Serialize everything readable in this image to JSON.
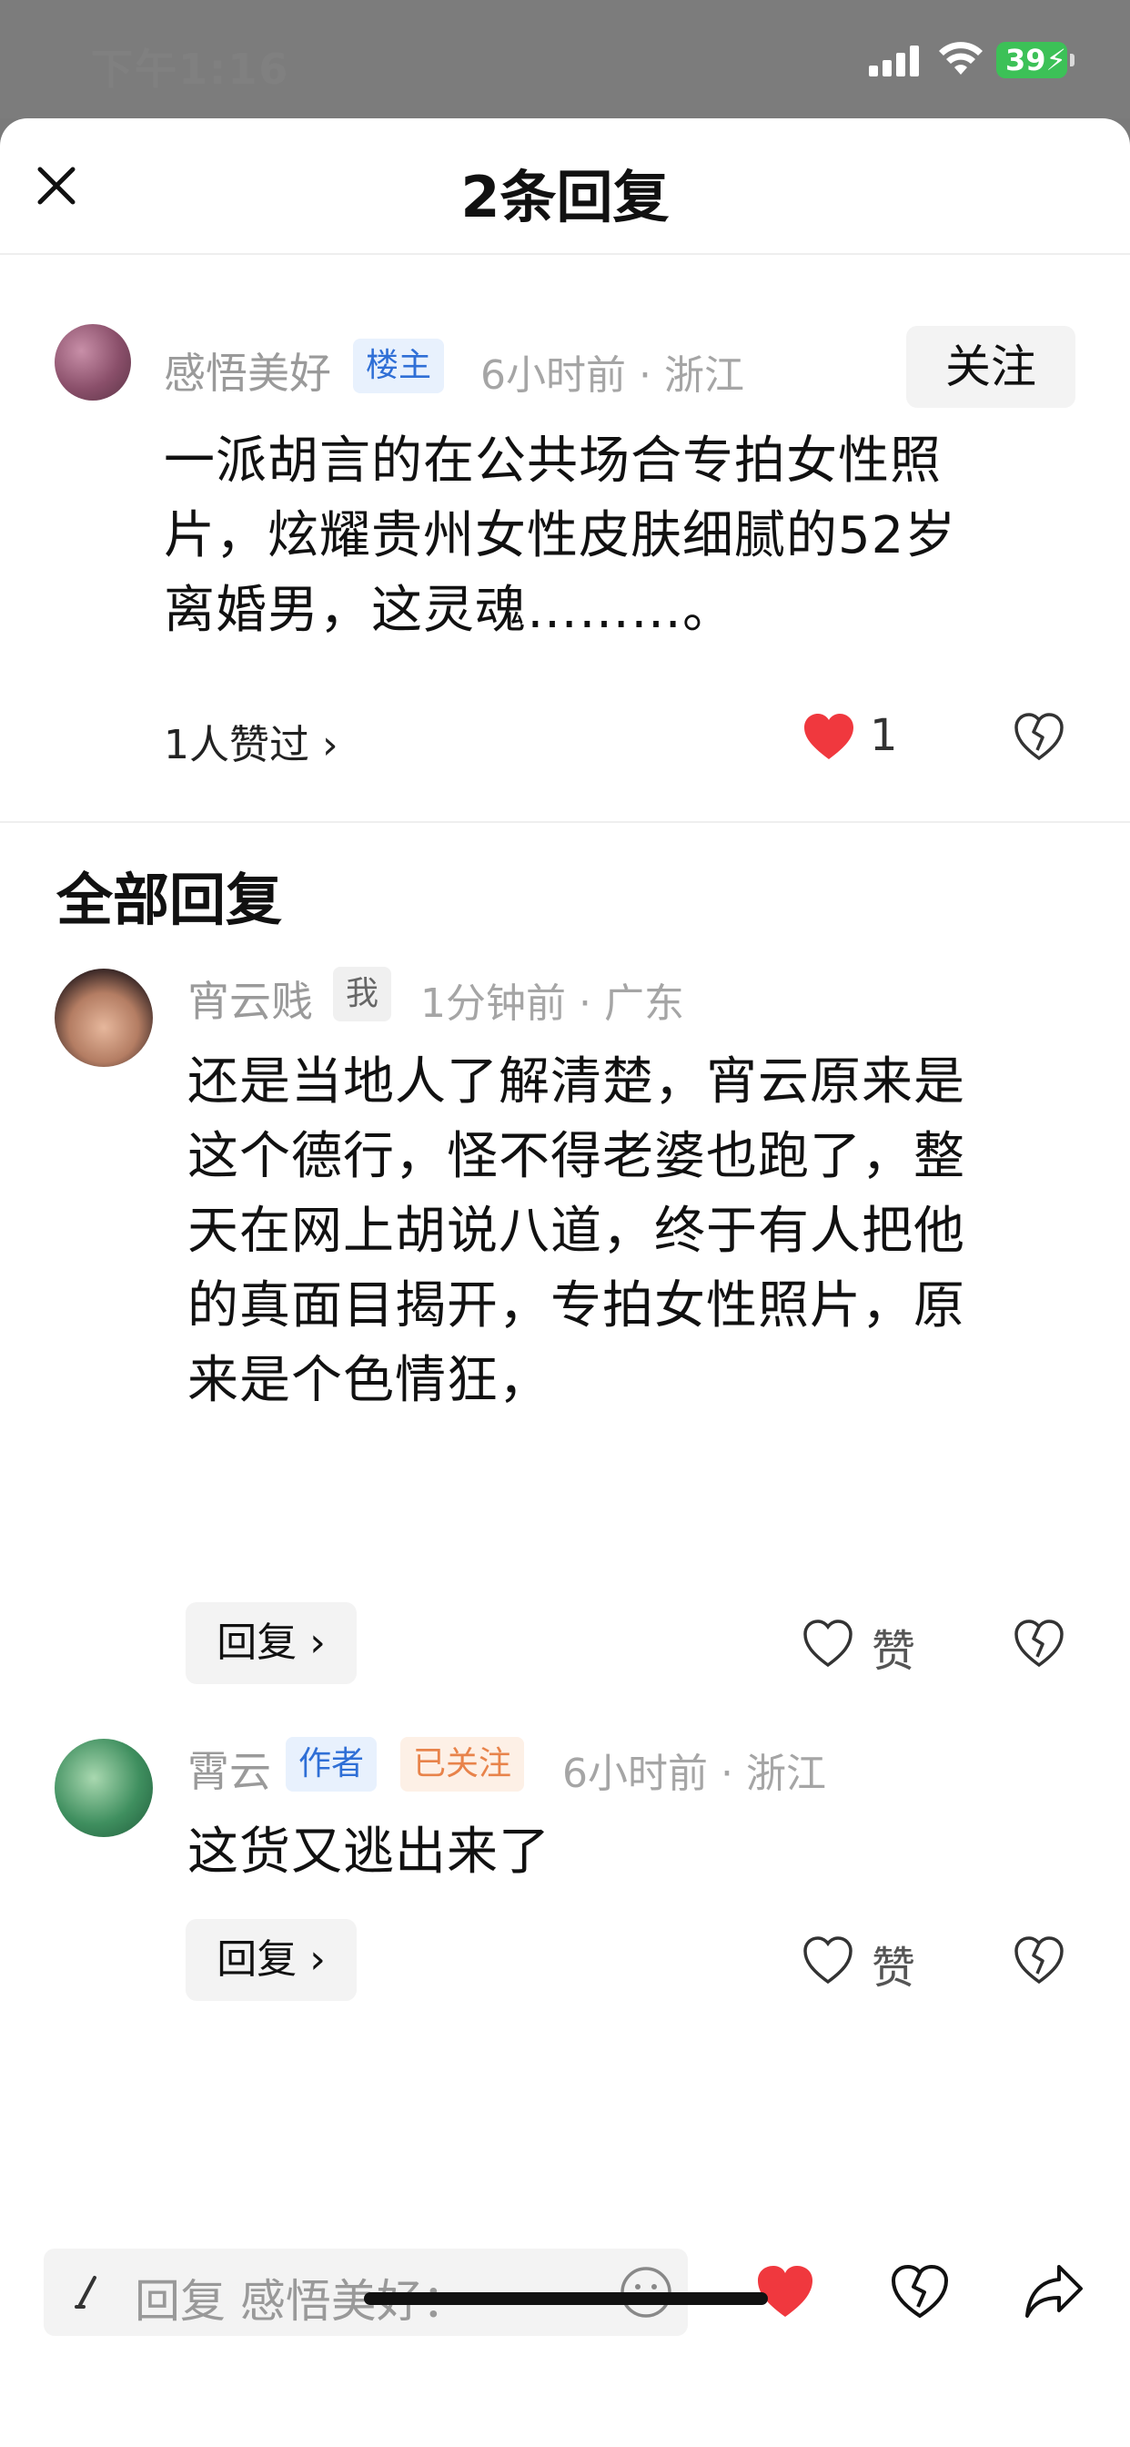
{
  "status_bar": {
    "time": "下午1:16",
    "battery": "39"
  },
  "header": {
    "title": "2条回复",
    "close_icon": "close-icon"
  },
  "main_comment": {
    "username": "感悟美好",
    "tag": "楼主",
    "meta": "6小时前 · 浙江",
    "follow_label": "关注",
    "text_lines": [
      "一派胡言的在公共场合专拍女性照",
      "片，炫耀贵州女性皮肤细腻的52岁",
      "离婚男，这灵魂………。"
    ],
    "likers": "1人赞过 ›",
    "like_count": "1"
  },
  "section_title": "全部回复",
  "replies": [
    {
      "username": "宵云贱",
      "tag": "我",
      "meta": "1分钟前 · 广东",
      "text_lines": [
        "还是当地人了解清楚，宵云原来是",
        "这个德行，怪不得老婆也跑了，整",
        "天在网上胡说八道，终于有人把他",
        "的真面目揭开，专拍女性照片，原",
        "来是个色情狂，"
      ],
      "reply_label": "回复",
      "like_label": "赞"
    },
    {
      "username": "霄云",
      "tag": "作者",
      "tag2": "已关注",
      "meta": "6小时前 · 浙江",
      "text_lines": [
        "这货又逃出来了"
      ],
      "reply_label": "回复",
      "like_label": "赞"
    }
  ],
  "bottom_bar": {
    "input_placeholder": "回复 感悟美好："
  },
  "colors": {
    "accent_red": "#f0383e",
    "tag_blue": "#2f6fd6",
    "tag_orange": "#e8834a"
  }
}
